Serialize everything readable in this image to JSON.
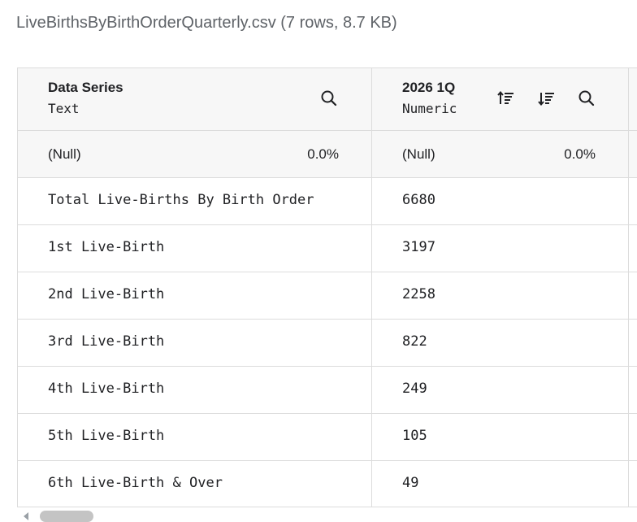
{
  "file": {
    "title": "LiveBirthsByBirthOrderQuarterly.csv (7 rows, 8.7 KB)"
  },
  "columns": [
    {
      "name": "Data Series",
      "type": "Text",
      "null_label": "(Null)",
      "null_pct": "0.0%"
    },
    {
      "name": "2026 1Q",
      "type": "Numeric",
      "null_label": "(Null)",
      "null_pct": "0.0%"
    }
  ],
  "icons": {
    "search": "search-icon",
    "sort_asc": "sort-ascending-icon",
    "sort_desc": "sort-descending-icon"
  },
  "rows": [
    {
      "series": "Total Live-Births By Birth Order",
      "value": "6680"
    },
    {
      "series": "1st Live-Birth",
      "value": "3197"
    },
    {
      "series": "2nd Live-Birth",
      "value": "2258"
    },
    {
      "series": "3rd Live-Birth",
      "value": "822"
    },
    {
      "series": "4th Live-Birth",
      "value": "249"
    },
    {
      "series": "5th Live-Birth",
      "value": "105"
    },
    {
      "series": "6th Live-Birth & Over",
      "value": "49"
    }
  ]
}
